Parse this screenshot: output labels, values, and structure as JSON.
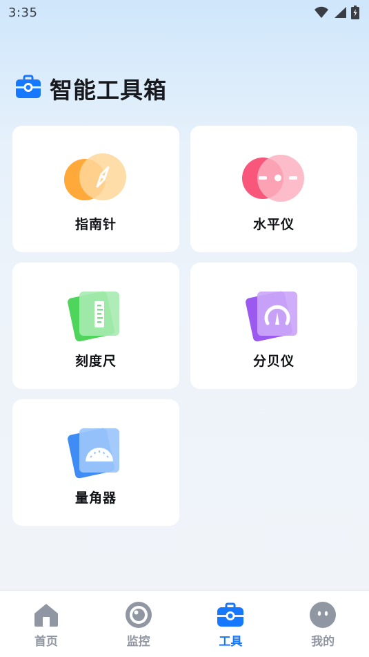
{
  "status_bar": {
    "time": "3:35",
    "icons": [
      "wifi-icon",
      "signal-icon",
      "battery-charging-icon"
    ]
  },
  "header": {
    "icon": "toolbox-icon",
    "title": "智能工具箱"
  },
  "tools": [
    {
      "id": "compass",
      "icon": "compass-icon",
      "label": "指南针"
    },
    {
      "id": "level",
      "icon": "level-icon",
      "label": "水平仪"
    },
    {
      "id": "ruler",
      "icon": "ruler-icon",
      "label": "刻度尺"
    },
    {
      "id": "decibel",
      "icon": "decibel-meter-icon",
      "label": "分贝仪"
    },
    {
      "id": "protractor",
      "icon": "protractor-icon",
      "label": "量角器"
    }
  ],
  "bottom_nav": {
    "active": "tools",
    "items": [
      {
        "id": "home",
        "icon": "home-icon",
        "label": "首页"
      },
      {
        "id": "monitor",
        "icon": "camera-lens-icon",
        "label": "监控"
      },
      {
        "id": "tools",
        "icon": "toolbox-icon",
        "label": "工具"
      },
      {
        "id": "mine",
        "icon": "profile-face-icon",
        "label": "我的"
      }
    ]
  },
  "colors": {
    "accent": "#1677ff",
    "inactive_nav": "#9097a3",
    "compass": "#ffa93a",
    "level": "#f8567a",
    "ruler": "#4fd45c",
    "decibel": "#9b59f0",
    "protractor": "#3f8cf5"
  }
}
